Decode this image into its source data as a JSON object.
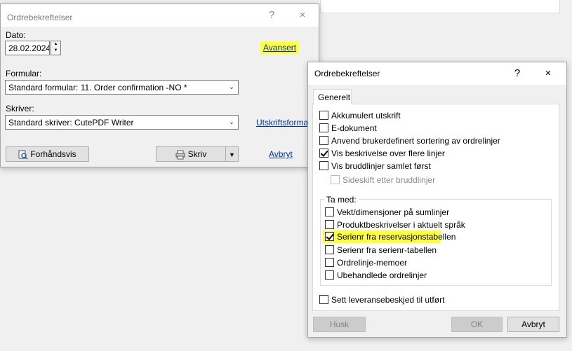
{
  "main_dialog": {
    "title": "Ordrebekreftelser",
    "help_label": "?",
    "close_label": "×",
    "date_label": "Dato:",
    "date_value": "28.02.2024",
    "advanced_link": "Avansert",
    "form_label": "Formular:",
    "form_value": "Standard formular: 11. Order confirmation -NO *",
    "printer_label": "Skriver:",
    "printer_value": "Standard skriver: CutePDF Writer",
    "print_format_link": "Utskriftsformat",
    "preview_button": "Forhåndsvis",
    "print_button": "Skriv",
    "cancel_link": "Avbryt"
  },
  "options_dialog": {
    "title": "Ordrebekreftelser",
    "help_label": "?",
    "close_label": "×",
    "tab_label": "Generelt",
    "options": [
      {
        "label": "Akkumulert utskrift",
        "checked": false
      },
      {
        "label": "E-dokument",
        "checked": false
      },
      {
        "label": "Anvend brukerdefinert sortering av ordrelinjer",
        "checked": false
      },
      {
        "label": "Vis beskrivelse over flere linjer",
        "checked": true
      },
      {
        "label": "Vis bruddlinjer samlet først",
        "checked": false
      },
      {
        "label": "Sideskift etter bruddlinjer",
        "checked": false,
        "disabled": true
      }
    ],
    "include_group_title": "Ta med:",
    "include_options": [
      {
        "label": "Vekt/dimensjoner på sumlinjer",
        "checked": false
      },
      {
        "label": "Produktbeskrivelser i aktuelt språk",
        "checked": false
      },
      {
        "label": "Serienr fra reservasjonstabellen",
        "checked": true,
        "highlighted": true
      },
      {
        "label": "Serienr fra serienr-tabellen",
        "checked": false
      },
      {
        "label": "Ordrelinje-memoer",
        "checked": false
      },
      {
        "label": "Ubehandlede ordrelinjer",
        "checked": false
      }
    ],
    "delivery_option": {
      "label": "Sett leveransebeskjed til utført",
      "checked": false
    },
    "remember_button": "Husk",
    "ok_button": "OK",
    "cancel_button": "Avbryt"
  },
  "colors": {
    "highlight": "#ffff3c",
    "link": "#0033aa"
  }
}
